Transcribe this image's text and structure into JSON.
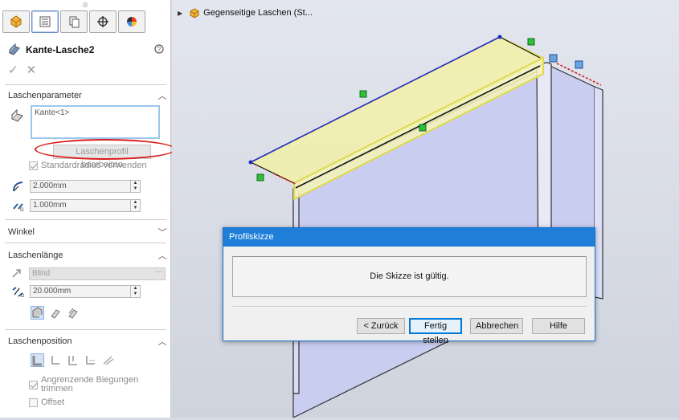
{
  "feature": {
    "name": "Kante-Lasche2",
    "help_icon": "help-circle-icon"
  },
  "sections": {
    "params": {
      "title": "Laschenparameter",
      "edge_list_item": "Kante<1>",
      "edit_profile_button": "Laschenprofil bearbeiten",
      "default_radius_label": "Standardradius verwenden",
      "radius_value": "2.000mm",
      "gap_value": "1.000mm"
    },
    "angle": {
      "title": "Winkel"
    },
    "length": {
      "title": "Laschenlänge",
      "end_condition": "Blind",
      "length_value": "20.000mm"
    },
    "position": {
      "title": "Laschenposition",
      "trim_label": "Angrenzende Biegungen trimmen",
      "offset_label": "Offset"
    }
  },
  "tree": {
    "label": "Gegenseitige Laschen  (St..."
  },
  "dialog": {
    "title": "Profilskizze",
    "message": "Die Skizze ist gültig.",
    "buttons": {
      "back": "< Zurück",
      "finish": "Fertig stellen",
      "cancel": "Abbrechen",
      "help": "Hilfe"
    }
  },
  "colors": {
    "accent": "#1f7fd8",
    "highlight_ring": "#d81e1e",
    "selection_face": "#f3f0a8",
    "part_face": "#c9cdf0"
  }
}
